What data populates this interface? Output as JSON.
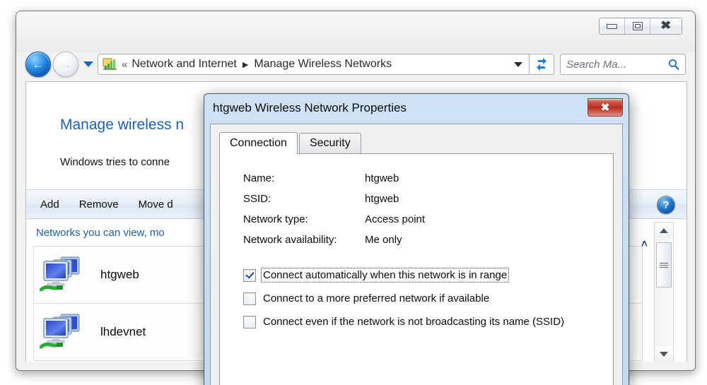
{
  "explorer": {
    "window_controls": [
      {
        "name": "minimize",
        "glyph": "minimize-icon"
      },
      {
        "name": "maximize",
        "glyph": "maximize-icon"
      },
      {
        "name": "close",
        "glyph": "close-icon",
        "label": "✖"
      }
    ],
    "nav": {
      "back_arrow": "←",
      "forward_arrow": "→",
      "history_dropdown": "history-dropdown"
    },
    "address": {
      "overflow_chevrons": "«",
      "segments": [
        "Network and Internet",
        "Manage Wireless Networks"
      ],
      "separator": "▶",
      "dropdown": "address-dropdown",
      "refresh": "refresh-icon"
    },
    "search": {
      "placeholder": "Search Ma...",
      "icon": "search-icon"
    },
    "page": {
      "heading": "Manage wireless n",
      "subtitle": "Windows tries to conne"
    },
    "toolbar": {
      "items": [
        "Add",
        "Remove",
        "Move d"
      ],
      "help_label": "?"
    },
    "list": {
      "header": "Networks you can view, mo",
      "items": [
        {
          "name": "htgweb"
        },
        {
          "name": "lhdevnet"
        }
      ]
    },
    "scrollbar": {
      "up": "scroll-up-arrow",
      "down": "scroll-down-arrow"
    },
    "collapse_chevron": "˄"
  },
  "dialog": {
    "title": "htgweb Wireless Network Properties",
    "close_label": "✖",
    "tabs": [
      {
        "label": "Connection",
        "active": true
      },
      {
        "label": "Security",
        "active": false
      }
    ],
    "fields": [
      {
        "label": "Name:",
        "value": "htgweb"
      },
      {
        "label": "SSID:",
        "value": "htgweb"
      },
      {
        "label": "Network type:",
        "value": "Access point"
      },
      {
        "label": "Network availability:",
        "value": "Me only"
      }
    ],
    "checkboxes": [
      {
        "label": "Connect automatically when this network is in range",
        "checked": true,
        "focused": true
      },
      {
        "label": "Connect to a more preferred network if available",
        "checked": false,
        "focused": false
      },
      {
        "label": "Connect even if the network is not broadcasting its name (SSID)",
        "checked": false,
        "focused": false
      }
    ]
  },
  "colors": {
    "heading_blue": "#1c5fb3",
    "link_blue": "#1c5fb3",
    "close_red": "#b62f22",
    "accent_blue": "#2076cf"
  }
}
